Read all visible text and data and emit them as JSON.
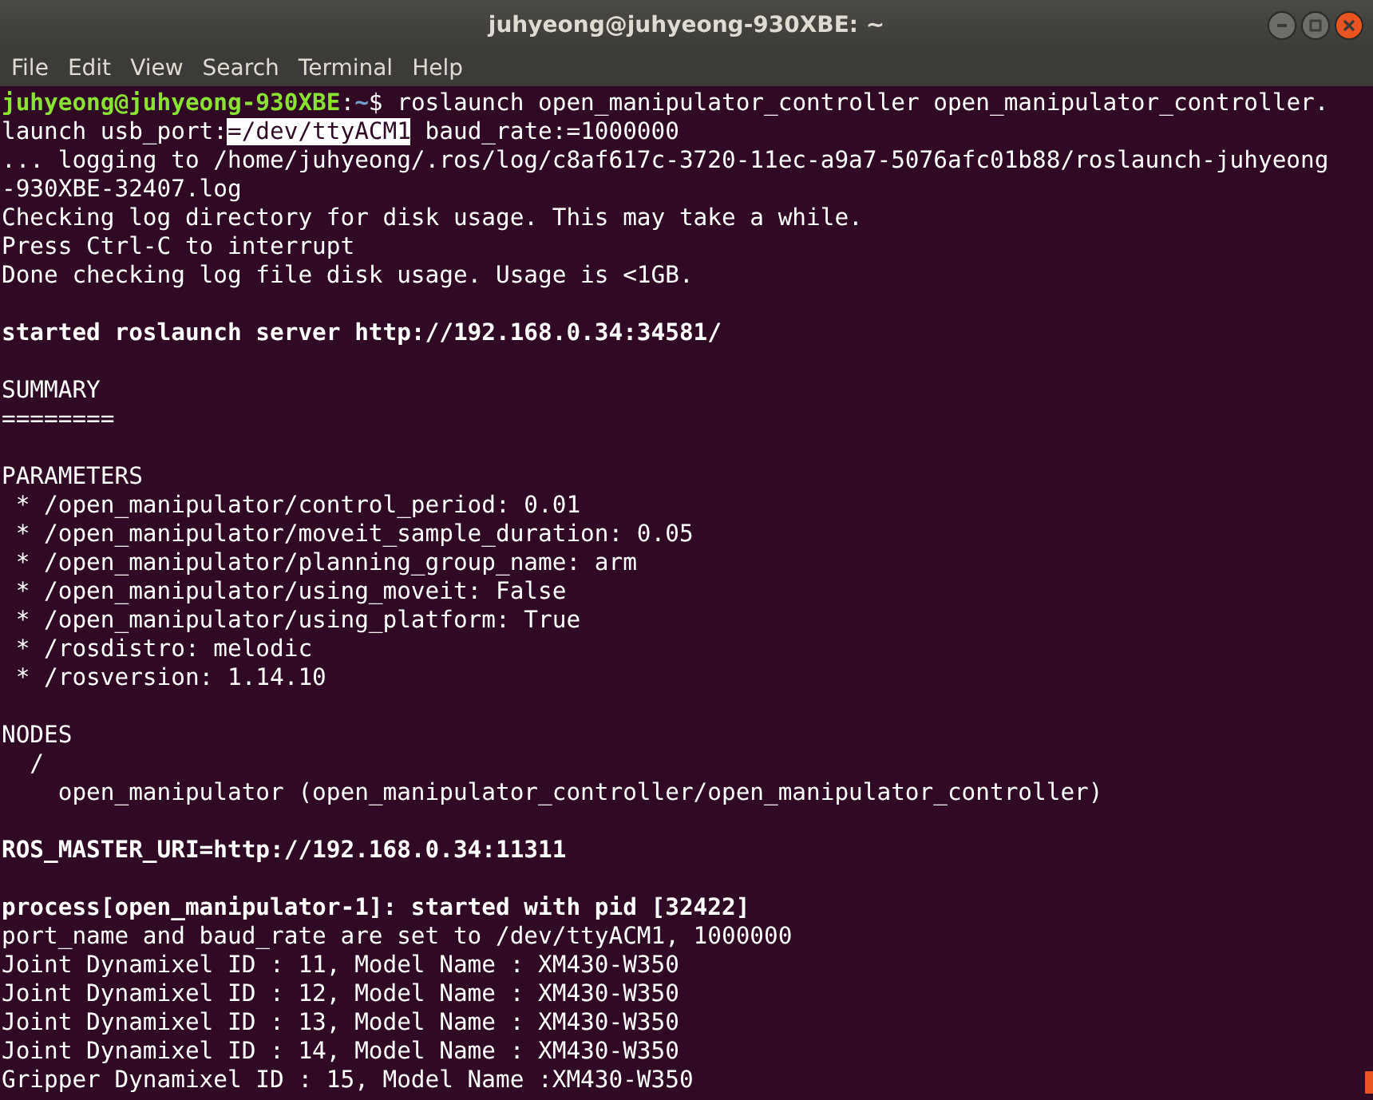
{
  "window": {
    "title": "juhyeong@juhyeong-930XBE: ~"
  },
  "menu": [
    "File",
    "Edit",
    "View",
    "Search",
    "Terminal",
    "Help"
  ],
  "terminal": {
    "lines": [
      {
        "kind": "text",
        "segments": [
          {
            "kind": "user",
            "text": "juhyeong@juhyeong-930XBE"
          },
          {
            "kind": "plain",
            "text": ":"
          },
          {
            "kind": "path",
            "text": "~"
          },
          {
            "kind": "plain",
            "text": "$ roslaunch open_manipulator_controller open_manipulator_controller."
          }
        ]
      },
      {
        "kind": "text",
        "segments": [
          {
            "kind": "plain",
            "text": "launch usb_port:"
          },
          {
            "kind": "selected",
            "text": "=/dev/ttyACM1"
          },
          {
            "kind": "plain",
            "text": " baud_rate:=1000000"
          }
        ]
      },
      {
        "kind": "text",
        "segments": [
          {
            "kind": "plain",
            "text": "... logging to /home/juhyeong/.ros/log/c8af617c-3720-11ec-a9a7-5076afc01b88/roslaunch-juhyeong"
          }
        ]
      },
      {
        "kind": "text",
        "segments": [
          {
            "kind": "plain",
            "text": "-930XBE-32407.log"
          }
        ]
      },
      {
        "kind": "text",
        "segments": [
          {
            "kind": "plain",
            "text": "Checking log directory for disk usage. This may take a while."
          }
        ]
      },
      {
        "kind": "text",
        "segments": [
          {
            "kind": "plain",
            "text": "Press Ctrl-C to interrupt"
          }
        ]
      },
      {
        "kind": "text",
        "segments": [
          {
            "kind": "plain",
            "text": "Done checking log file disk usage. Usage is <1GB."
          }
        ]
      },
      {
        "kind": "blank"
      },
      {
        "kind": "text",
        "segments": [
          {
            "kind": "bold",
            "text": "started roslaunch server http://192.168.0.34:34581/"
          }
        ]
      },
      {
        "kind": "blank"
      },
      {
        "kind": "text",
        "segments": [
          {
            "kind": "plain",
            "text": "SUMMARY"
          }
        ]
      },
      {
        "kind": "text",
        "segments": [
          {
            "kind": "plain",
            "text": "========"
          }
        ]
      },
      {
        "kind": "blank"
      },
      {
        "kind": "text",
        "segments": [
          {
            "kind": "plain",
            "text": "PARAMETERS"
          }
        ]
      },
      {
        "kind": "text",
        "segments": [
          {
            "kind": "plain",
            "text": " * /open_manipulator/control_period: 0.01"
          }
        ]
      },
      {
        "kind": "text",
        "segments": [
          {
            "kind": "plain",
            "text": " * /open_manipulator/moveit_sample_duration: 0.05"
          }
        ]
      },
      {
        "kind": "text",
        "segments": [
          {
            "kind": "plain",
            "text": " * /open_manipulator/planning_group_name: arm"
          }
        ]
      },
      {
        "kind": "text",
        "segments": [
          {
            "kind": "plain",
            "text": " * /open_manipulator/using_moveit: False"
          }
        ]
      },
      {
        "kind": "text",
        "segments": [
          {
            "kind": "plain",
            "text": " * /open_manipulator/using_platform: True"
          }
        ]
      },
      {
        "kind": "text",
        "segments": [
          {
            "kind": "plain",
            "text": " * /rosdistro: melodic"
          }
        ]
      },
      {
        "kind": "text",
        "segments": [
          {
            "kind": "plain",
            "text": " * /rosversion: 1.14.10"
          }
        ]
      },
      {
        "kind": "blank"
      },
      {
        "kind": "text",
        "segments": [
          {
            "kind": "plain",
            "text": "NODES"
          }
        ]
      },
      {
        "kind": "text",
        "segments": [
          {
            "kind": "plain",
            "text": "  /"
          }
        ]
      },
      {
        "kind": "text",
        "segments": [
          {
            "kind": "plain",
            "text": "    open_manipulator (open_manipulator_controller/open_manipulator_controller)"
          }
        ]
      },
      {
        "kind": "blank"
      },
      {
        "kind": "text",
        "segments": [
          {
            "kind": "bold",
            "text": "ROS_MASTER_URI=http://192.168.0.34:11311"
          }
        ]
      },
      {
        "kind": "blank"
      },
      {
        "kind": "text",
        "segments": [
          {
            "kind": "bold",
            "text": "process[open_manipulator-1]: started with pid [32422]"
          }
        ]
      },
      {
        "kind": "text",
        "segments": [
          {
            "kind": "plain",
            "text": "port_name and baud_rate are set to /dev/ttyACM1, 1000000"
          }
        ]
      },
      {
        "kind": "text",
        "segments": [
          {
            "kind": "plain",
            "text": "Joint Dynamixel ID : 11, Model Name : XM430-W350"
          }
        ]
      },
      {
        "kind": "text",
        "segments": [
          {
            "kind": "plain",
            "text": "Joint Dynamixel ID : 12, Model Name : XM430-W350"
          }
        ]
      },
      {
        "kind": "text",
        "segments": [
          {
            "kind": "plain",
            "text": "Joint Dynamixel ID : 13, Model Name : XM430-W350"
          }
        ]
      },
      {
        "kind": "text",
        "segments": [
          {
            "kind": "plain",
            "text": "Joint Dynamixel ID : 14, Model Name : XM430-W350"
          }
        ]
      },
      {
        "kind": "text",
        "segments": [
          {
            "kind": "plain",
            "text": "Gripper Dynamixel ID : 15, Model Name :XM430-W350"
          }
        ]
      }
    ]
  }
}
